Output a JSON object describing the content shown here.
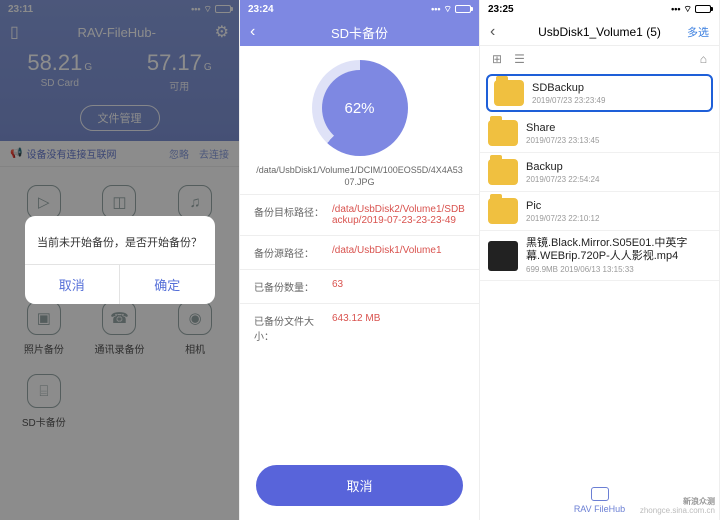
{
  "phone1": {
    "time": "23:11",
    "title": "RAV-FileHub-",
    "sd": {
      "value": "58.21",
      "unit": "G",
      "label": "SD Card"
    },
    "free": {
      "value": "57.17",
      "unit": "G",
      "label": "可用"
    },
    "manage_btn": "文件管理",
    "alert_text": "设备没有连接互联网",
    "alert_ignore": "忽略",
    "alert_connect": "去连接",
    "items": [
      {
        "glyph": "▷",
        "label": ""
      },
      {
        "glyph": "◫",
        "label": ""
      },
      {
        "glyph": "♫",
        "label": ""
      },
      {
        "glyph": "⧉",
        "label": ""
      },
      {
        "glyph": "⋯",
        "label": ""
      },
      {
        "glyph": "",
        "label": ""
      },
      {
        "glyph": "▣",
        "label": "照片备份"
      },
      {
        "glyph": "☎",
        "label": "通讯录备份"
      },
      {
        "glyph": "◉",
        "label": "相机"
      },
      {
        "glyph": "⌸",
        "label": "SD卡备份"
      }
    ],
    "dialog": {
      "message": "当前未开始备份，是否开始备份？",
      "cancel": "取消",
      "ok": "确定"
    }
  },
  "phone2": {
    "time": "23:24",
    "title": "SD卡备份",
    "percent": "62%",
    "current_path": "/data/UsbDisk1/Volume1/DCIM/100EOS5D/4X4A5307.JPG",
    "rows": {
      "target_k": "备份目标路径：",
      "target_v": "/data/UsbDisk2/Volume1/SDBackup/2019-07-23-23-23-49",
      "source_k": "备份源路径：",
      "source_v": "/data/UsbDisk1/Volume1",
      "count_k": "已备份数量：",
      "count_v": "63",
      "size_k": "已备份文件大小：",
      "size_v": "643.12 MB"
    },
    "cancel": "取消"
  },
  "phone3": {
    "time": "23:25",
    "title": "UsbDisk1_Volume1 (5)",
    "multi": "多选",
    "items": [
      {
        "type": "folder",
        "name": "SDBackup",
        "meta": "2019/07/23 23:23:49",
        "highlight": true
      },
      {
        "type": "folder",
        "name": "Share",
        "meta": "2019/07/23 23:13:45"
      },
      {
        "type": "folder",
        "name": "Backup",
        "meta": "2019/07/23 22:54:24"
      },
      {
        "type": "folder",
        "name": "Pic",
        "meta": "2019/07/23 22:10:12"
      },
      {
        "type": "file",
        "name": "黑镜.Black.Mirror.S05E01.中英字幕.WEBrip.720P-人人影视.mp4",
        "meta": "699.9MB 2019/06/13 13:15:33"
      }
    ],
    "bottom": "RAV FileHub"
  },
  "watermark": {
    "brand": "新浪众测",
    "sub": "zhongce.sina.com.cn"
  }
}
